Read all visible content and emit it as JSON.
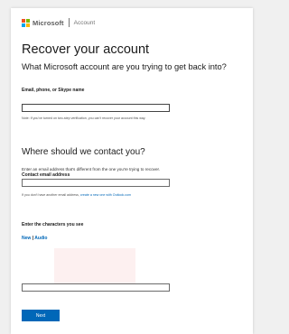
{
  "header": {
    "brand": "Microsoft",
    "section": "Account",
    "logo_colors": [
      "#f25022",
      "#7fba00",
      "#00a4ef",
      "#ffb900"
    ]
  },
  "page": {
    "title": "Recover your account",
    "subtitle": "What Microsoft account are you trying to get back into?"
  },
  "account_field": {
    "label": "Email, phone, or Skype name",
    "value": "",
    "note": "Note: If you've turned on two-step verification, you can't recover your account this way."
  },
  "contact": {
    "heading": "Where should we contact you?",
    "instruction": "Enter an email address that's different from the one you're trying to recover.",
    "label": "Contact email address",
    "value": "",
    "help_prefix": "If you don't have another email address, ",
    "help_link": "create a new one with Outlook.com"
  },
  "captcha": {
    "label": "Enter the characters you see",
    "new_link": "New",
    "separator": "|",
    "audio_link": "Audio",
    "value": ""
  },
  "actions": {
    "next_label": "Next"
  },
  "colors": {
    "accent": "#0067b8",
    "background": "#f0f0f0",
    "card": "#ffffff"
  }
}
